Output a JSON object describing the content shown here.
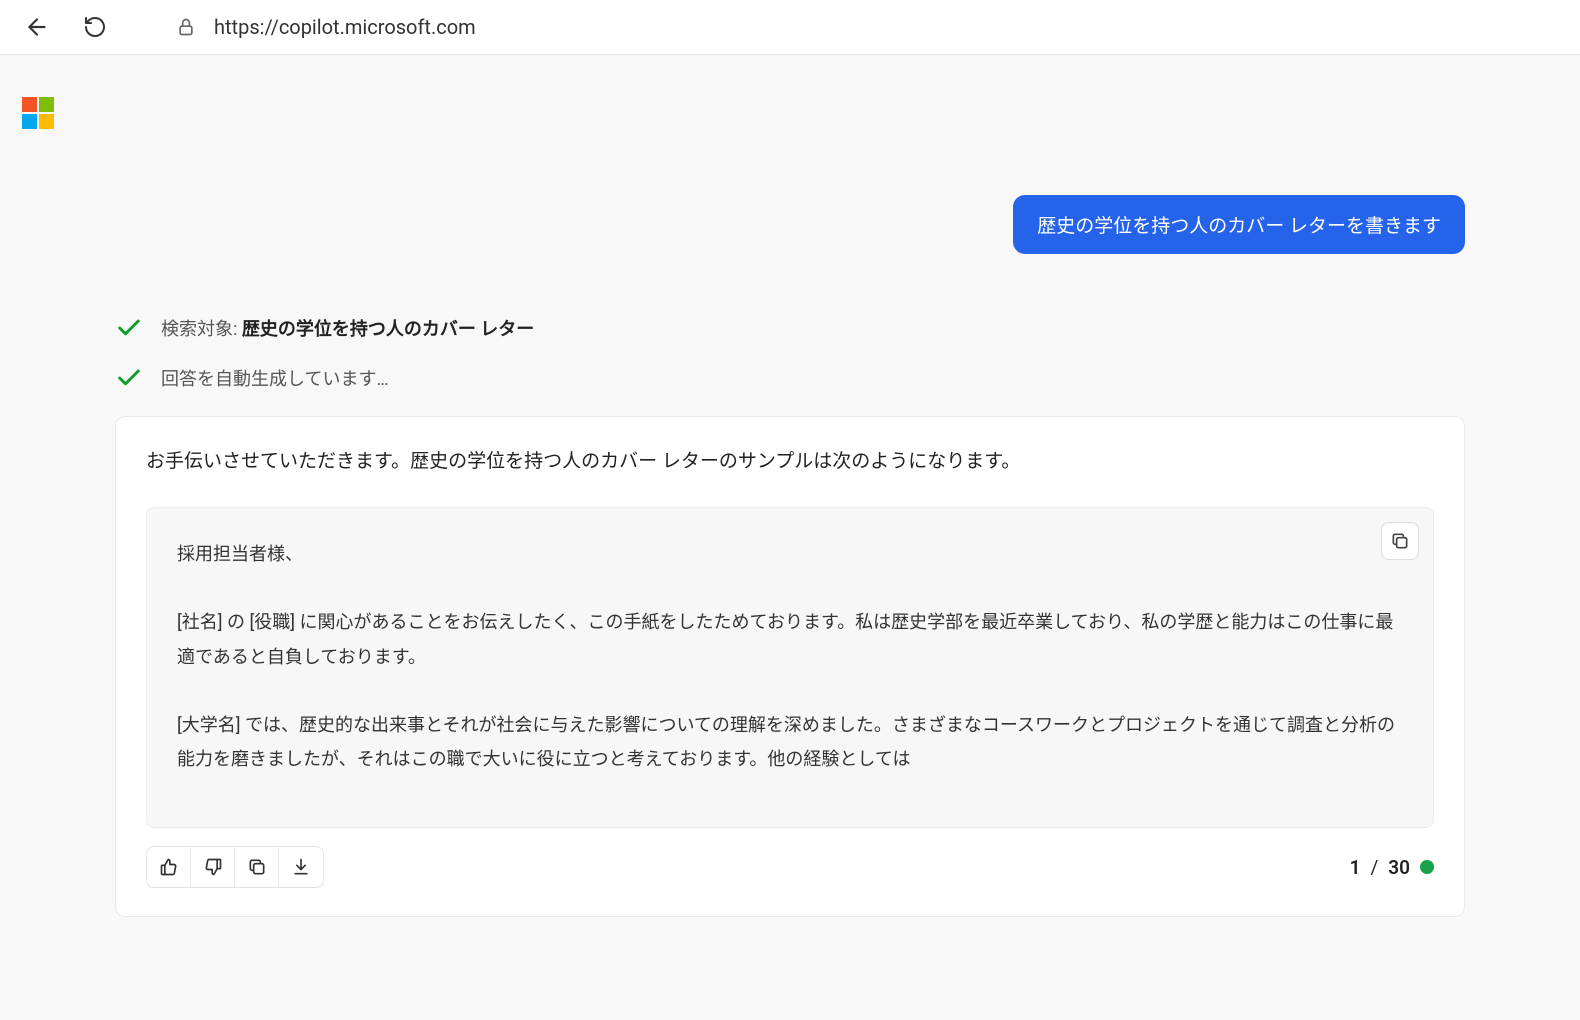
{
  "browser": {
    "url": "https://copilot.microsoft.com"
  },
  "chat": {
    "user_message": "歴史の学位を持つ人のカバー レターを書きます",
    "status": {
      "search_label": "検索対象: ",
      "search_query": "歴史の学位を持つ人のカバー レター",
      "generating": "回答を自動生成しています…"
    },
    "response": {
      "intro": "お手伝いさせていただきます。歴史の学位を持つ人のカバー レターのサンプルは次のようになります。",
      "letter": {
        "p1": "採用担当者様、",
        "p2": "[社名] の [役職] に関心があることをお伝えしたく、この手紙をしたためております。私は歴史学部を最近卒業しており、私の学歴と能力はこの仕事に最適であると自負しております。",
        "p3": "[大学名] では、歴史的な出来事とそれが社会に与えた影響についての理解を深めました。さまざまなコースワークとプロジェクトを通じて調査と分析の能力を磨きましたが、それはこの職で大いに役に立つと考えております。他の経験としては"
      }
    },
    "pagination": {
      "current": "1",
      "total": "30"
    }
  }
}
